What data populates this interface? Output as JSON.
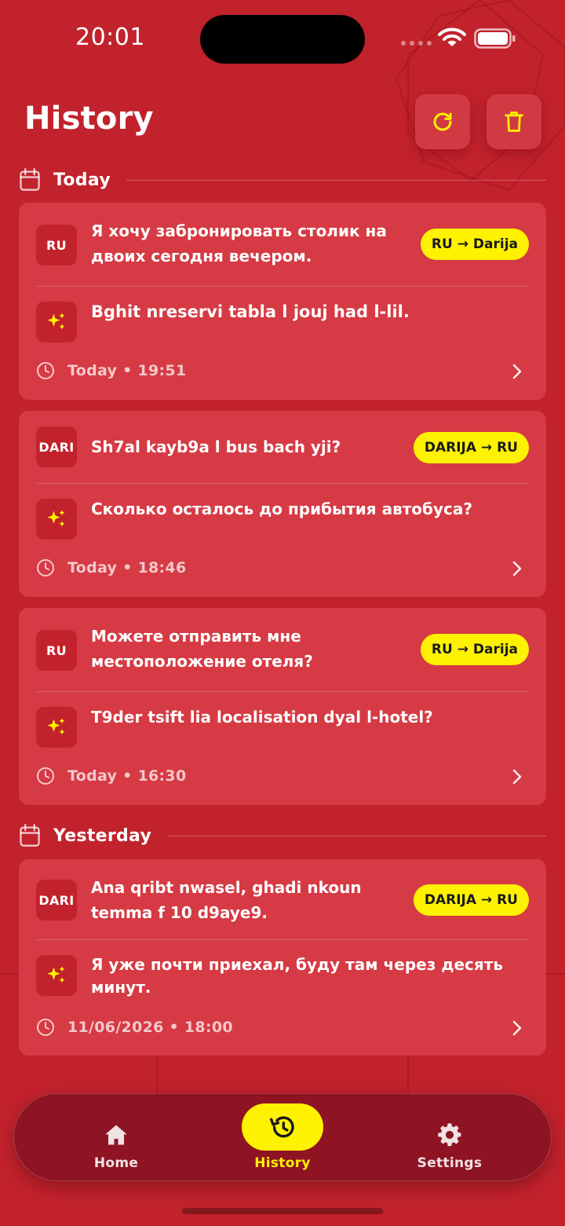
{
  "status_bar": {
    "time": "20:01"
  },
  "header": {
    "title": "History"
  },
  "sections": {
    "today": "Today",
    "yesterday": "Yesterday"
  },
  "cards": [
    {
      "badge": "RU",
      "source_line1": "Я хочу забронировать столик на",
      "source_line2": "двоих сегодня вечером.",
      "direction": "RU → Darija",
      "translation": "Bghit nreservi tabla l jouj had l-lil.",
      "time": "Today • 19:51"
    },
    {
      "badge": "DARI",
      "source_line1": "Sh7al kayb9a l bus bach yji?",
      "direction": "DARIJA → RU",
      "translation": "Сколько осталось до прибытия автобуса?",
      "time": "Today • 18:46"
    },
    {
      "badge": "RU",
      "source_line1": "Можете отправить мне",
      "source_line2": "местоположение отеля?",
      "direction": "RU → Darija",
      "translation": "T9der tsift lia localisation dyal l-hotel?",
      "time": "Today • 16:30"
    },
    {
      "badge": "DARI",
      "source_line1": "Ana qribt nwasel, ghadi nkoun",
      "source_line2": "temma f 10 d9aye9.",
      "direction": "DARIJA → RU",
      "translation_line1": "Я уже почти приехал, буду там через десять",
      "translation_line2": "минут.",
      "time": "11/06/2026 • 18:00"
    }
  ],
  "nav": {
    "home": "Home",
    "history": "History",
    "settings": "Settings"
  },
  "colors": {
    "background": "#C1222C",
    "card": "#D63A44",
    "accent": "#FFF200",
    "nav_bg": "#8E1423"
  }
}
